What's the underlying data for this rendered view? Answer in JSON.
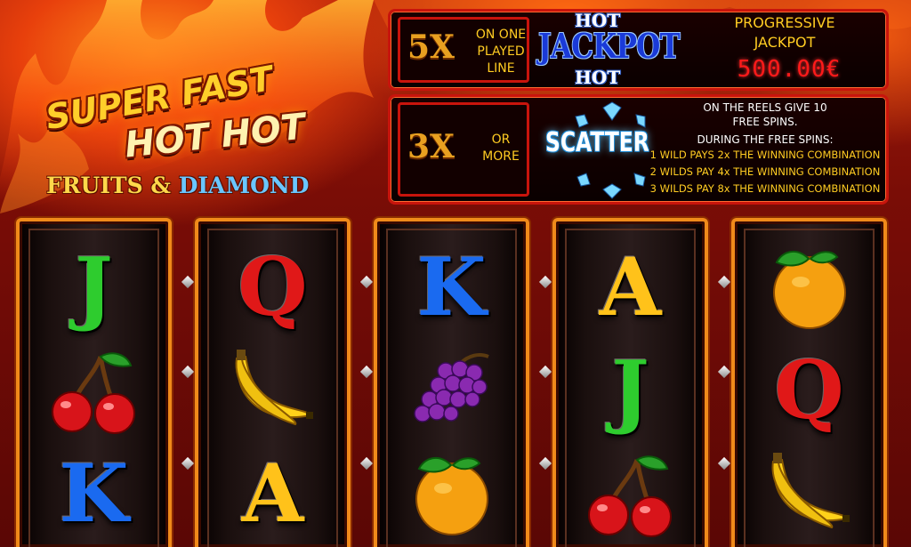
{
  "logo": {
    "line1": "SUPER FAST",
    "line2": "HOT HOT",
    "line3_a": "FRUITS &",
    "line3_b": "DIAMOND"
  },
  "jackpot_panel": {
    "multiplier": "5X",
    "condition_lines": [
      "ON ONE",
      "PLAYED",
      "LINE"
    ],
    "hot_top": "HOT",
    "jackpot_word": "JACKPOT",
    "hot_bottom": "HOT",
    "progressive_label_lines": [
      "PROGRESSIVE",
      "JACKPOT"
    ],
    "progressive_value": "500.00€"
  },
  "scatter_panel": {
    "multiplier": "3X",
    "condition_lines": [
      "OR",
      "MORE"
    ],
    "scatter_word": "SCATTER",
    "info_lines": [
      "ON THE REELS GIVE 10",
      "FREE SPINS.",
      "DURING THE FREE SPINS:"
    ],
    "wild_lines": [
      "1 WILD PAYS 2x THE WINNING COMBINATION",
      "2 WILDS PAY 4x THE WINNING COMBINATION",
      "3 WILDS PAY 8x THE WINNING COMBINATION"
    ]
  },
  "reels": [
    [
      "J",
      "cherry",
      "K"
    ],
    [
      "Q",
      "banana",
      "A"
    ],
    [
      "K",
      "grapes",
      "orange"
    ],
    [
      "A",
      "J",
      "cherry"
    ],
    [
      "orange",
      "Q",
      "banana"
    ]
  ],
  "symbol_colors": {
    "J": "#2ecc2e",
    "Q": "#e01818",
    "K": "#1a6af0",
    "A": "#ffc21a"
  },
  "colors": {
    "panel_border": "#c8140c",
    "reel_frame": "#f08a1a",
    "gold_text": "#ffcc22",
    "jackpot_digits": "#ff1a1a"
  }
}
